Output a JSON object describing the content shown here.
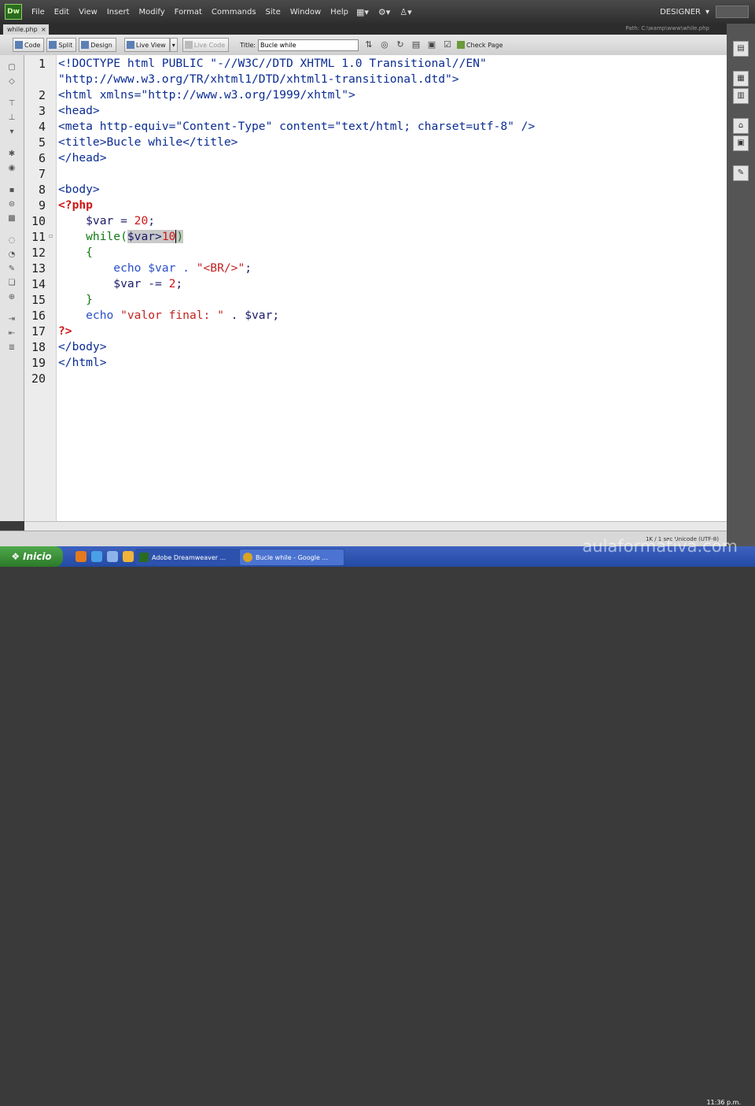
{
  "app": {
    "logo": "Dw",
    "menus": [
      "File",
      "Edit",
      "View",
      "Insert",
      "Modify",
      "Format",
      "Commands",
      "Site",
      "Window",
      "Help"
    ],
    "workspace": "DESIGNER"
  },
  "document": {
    "tab_name": "while.php",
    "path": "Path: C:\\wamp\\www\\while.php"
  },
  "toolbar": {
    "code": "Code",
    "split": "Split",
    "design": "Design",
    "live_view": "Live View",
    "live_code": "Live Code",
    "title_label": "Title:",
    "title_value": "Bucle while",
    "check_page": "Check Page"
  },
  "code": {
    "line_numbers": [
      "1",
      "",
      "2",
      "3",
      "4",
      "5",
      "6",
      "7",
      "8",
      "9",
      "10",
      "11",
      "12",
      "13",
      "14",
      "15",
      "16",
      "17",
      "18",
      "19",
      "20"
    ],
    "lines": {
      "l1": "<!DOCTYPE html PUBLIC \"-//W3C//DTD XHTML 1.0 Transitional//EN\"",
      "l1b": "\"http://www.w3.org/TR/xhtml1/DTD/xhtml1-transitional.dtd\">",
      "l2": "<html xmlns=\"http://www.w3.org/1999/xhtml\">",
      "l3": "<head>",
      "l4": "<meta http-equiv=\"Content-Type\" content=\"text/html; charset=utf-8\" />",
      "l5": "<title>Bucle while</title>",
      "l6": "</head>",
      "l8": "<body>",
      "l9": "<?php",
      "l10a": "    $var = ",
      "l10b": "20",
      "l10c": ";",
      "l11a": "    while(",
      "l11b": "$var>",
      "l11c": "10",
      "l11d": ")",
      "l12": "    {",
      "l13a": "        echo $var . ",
      "l13b": "\"<BR/>\"",
      "l13c": ";",
      "l14a": "        $var -= ",
      "l14b": "2",
      "l14c": ";",
      "l15": "    }",
      "l16a": "    echo ",
      "l16b": "\"valor final: \"",
      "l16c": " . $var;",
      "l17": "?>",
      "l18": "</body>",
      "l19": "</html>"
    }
  },
  "status": {
    "info": "1K / 1 sec  Unicode (UTF-8)"
  },
  "taskbar": {
    "start": "Inicio",
    "tasks": [
      "Adobe Dreamweaver ...",
      "Bucle while - Google ..."
    ],
    "clock": "11:36 p.m."
  },
  "watermark": "aulaformativa.com",
  "colors": {
    "tag": "#0a2c93",
    "php_delim": "#d01616",
    "keyword": "#0f7a10",
    "selection": "#c9c9c9"
  }
}
